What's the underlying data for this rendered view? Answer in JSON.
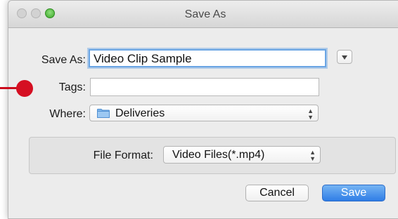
{
  "window": {
    "title": "Save As"
  },
  "form": {
    "save_as_label": "Save As:",
    "save_as_value": "Video Clip Sample",
    "tags_label": "Tags:",
    "tags_value": "",
    "where_label": "Where:",
    "where_value": "Deliveries",
    "file_format_label": "File Format:",
    "file_format_value": "Video Files(*.mp4)"
  },
  "buttons": {
    "cancel": "Cancel",
    "save": "Save"
  },
  "icons": {
    "window_controls": [
      "close-button-icon",
      "minimize-button-icon",
      "zoom-button-icon"
    ],
    "expand": "chevron-down-icon",
    "folder": "folder-icon",
    "stepper": "up-down-arrows-icon",
    "annotation": "red-pointer-marker"
  },
  "colors": {
    "accent": "#3b86ea",
    "annotation": "#d50f22",
    "focus_ring": "#6aa5e4"
  }
}
